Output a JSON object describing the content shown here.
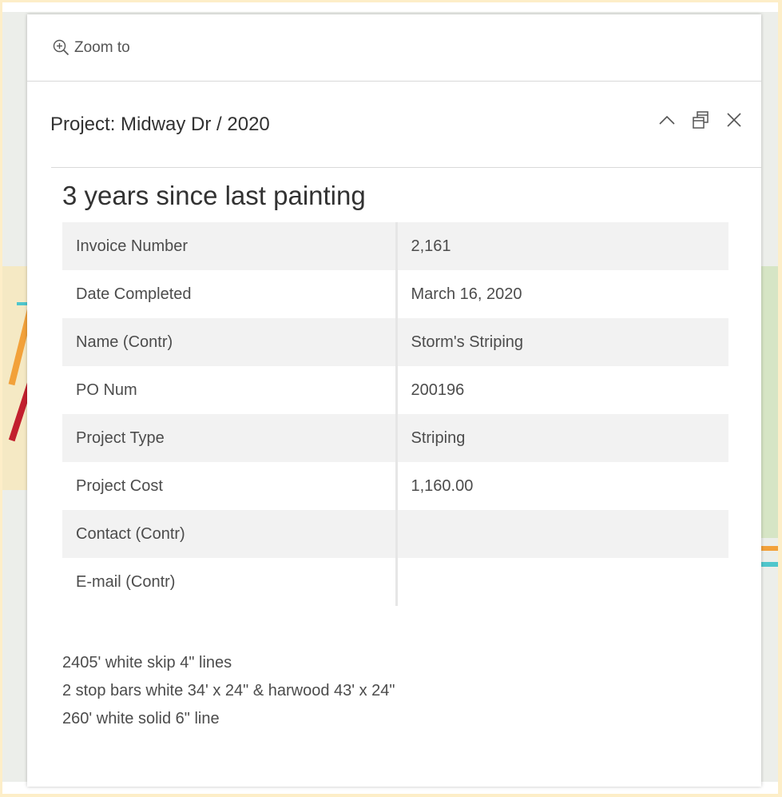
{
  "popup": {
    "zoom_label": "Zoom to",
    "title": "Project: Midway Dr / 2020",
    "heading": "3 years since last painting",
    "fields": [
      {
        "name": "Invoice Number",
        "value": "2,161"
      },
      {
        "name": "Date Completed",
        "value": "March 16, 2020"
      },
      {
        "name": "Name (Contr)",
        "value": "Storm's Striping"
      },
      {
        "name": "PO Num",
        "value": "200196"
      },
      {
        "name": "Project Type",
        "value": "Striping"
      },
      {
        "name": "Project Cost",
        "value": "1,160.00"
      },
      {
        "name": "Contact (Contr)",
        "value": ""
      },
      {
        "name": "E-mail (Contr)",
        "value": ""
      }
    ],
    "notes": [
      "2405' white skip 4\" lines",
      "2 stop bars white 34' x 24\" & harwood 43' x 24\"",
      "260' white solid 6\" line"
    ]
  },
  "icons": {
    "zoom": "zoom-in-icon",
    "collapse": "chevron-up-icon",
    "dock": "dock-icon",
    "close": "close-icon"
  },
  "colors": {
    "frame": "#fdeec8",
    "row_alt": "#f2f2f2",
    "text": "#323232"
  }
}
